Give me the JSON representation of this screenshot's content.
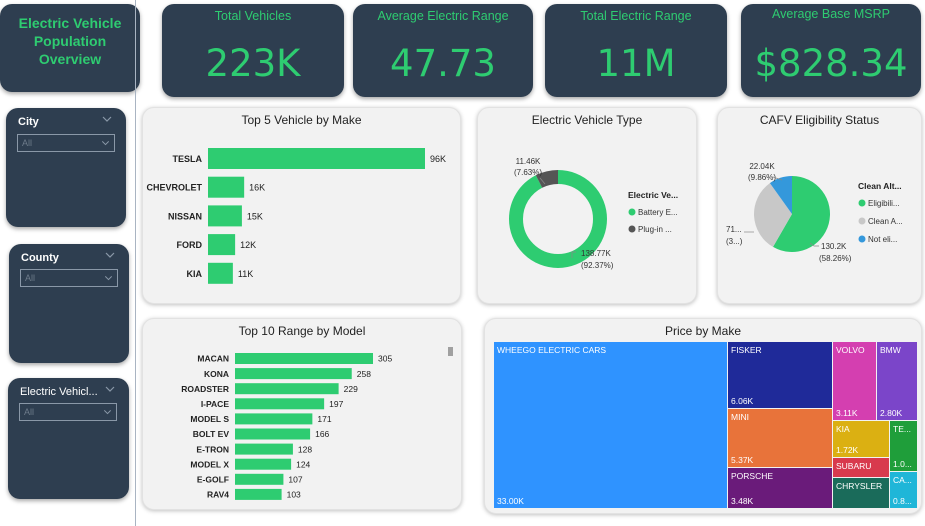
{
  "title": "Electric Vehicle Population Overview",
  "kpis": [
    {
      "label": "Total Vehicles",
      "value": "223K"
    },
    {
      "label": "Average Electric Range",
      "value": "47.73"
    },
    {
      "label": "Total Electric Range",
      "value": "11M"
    },
    {
      "label": "Average Base MSRP",
      "value": "$828.34"
    }
  ],
  "slicers": [
    {
      "title": "City",
      "value": "All"
    },
    {
      "title": "County",
      "value": "All"
    },
    {
      "title": "Electric Vehicl...",
      "value": "All"
    }
  ],
  "colors": {
    "accent": "#2ecc71",
    "panel": "#2e3e50",
    "card": "#f2f2f2"
  },
  "chart_data": [
    {
      "id": "top5make",
      "type": "bar",
      "orientation": "horizontal",
      "title": "Top 5 Vehicle by Make",
      "categories": [
        "TESLA",
        "CHEVROLET",
        "NISSAN",
        "FORD",
        "KIA"
      ],
      "values": [
        96,
        16,
        15,
        12,
        11
      ],
      "labels": [
        "96K",
        "16K",
        "15K",
        "12K",
        "11K"
      ],
      "color": "#2ecc71"
    },
    {
      "id": "evtype",
      "type": "pie",
      "variant": "donut",
      "title": "Electric Vehicle Type",
      "legend_title": "Electric Ve...",
      "slices": [
        {
          "name": "Battery E...",
          "value": 138.77,
          "label1": "138.77K",
          "label2": "(92.37%)",
          "color": "#2ecc71"
        },
        {
          "name": "Plug-in ...",
          "value": 11.46,
          "label1": "11.46K",
          "label2": "(7.63%)",
          "color": "#555555"
        }
      ]
    },
    {
      "id": "cafv",
      "type": "pie",
      "title": "CAFV Eligibility Status",
      "legend_title": "Clean Alt...",
      "slices": [
        {
          "name": "Eligibili...",
          "value": 130.2,
          "label1": "130.2K",
          "label2": "(58.26%)",
          "color": "#2ecc71"
        },
        {
          "name": "Clean A...",
          "value": 71,
          "label1": "71...",
          "label2": "(3...)",
          "color": "#c8c8c8"
        },
        {
          "name": "Not eli...",
          "value": 22.04,
          "label1": "22.04K",
          "label2": "(9.86%)",
          "color": "#3498db"
        }
      ]
    },
    {
      "id": "top10range",
      "type": "bar",
      "orientation": "horizontal",
      "title": "Top 10 Range by Model",
      "categories": [
        "MACAN",
        "KONA",
        "ROADSTER",
        "I-PACE",
        "MODEL S",
        "BOLT EV",
        "E-TRON",
        "MODEL X",
        "E-GOLF",
        "RAV4"
      ],
      "values": [
        305,
        258,
        229,
        197,
        171,
        166,
        128,
        124,
        107,
        103
      ],
      "color": "#2ecc71"
    },
    {
      "id": "pricebymake",
      "type": "treemap",
      "title": "Price by Make",
      "items": [
        {
          "name": "WHEEGO ELECTRIC CARS",
          "value": "33.00K",
          "color": "#2f93ff"
        },
        {
          "name": "FISKER",
          "value": "6.06K",
          "color": "#1f2a99"
        },
        {
          "name": "MINI",
          "value": "5.37K",
          "color": "#e8733a"
        },
        {
          "name": "PORSCHE",
          "value": "3.48K",
          "color": "#6a1b7a"
        },
        {
          "name": "VOLVO",
          "value": "3.11K",
          "color": "#d43fb0"
        },
        {
          "name": "BMW",
          "value": "2.80K",
          "color": "#7b45c9"
        },
        {
          "name": "KIA",
          "value": "1.72K",
          "color": "#dbb012"
        },
        {
          "name": "SUBARU",
          "value": "",
          "color": "#d83a4d"
        },
        {
          "name": "CHRYSLER",
          "value": "",
          "color": "#1a6b5a"
        },
        {
          "name": "TE...",
          "value": "1.0...",
          "color": "#1f9e3a"
        },
        {
          "name": "CA...",
          "value": "0.8...",
          "color": "#1fb6d8"
        }
      ]
    }
  ]
}
